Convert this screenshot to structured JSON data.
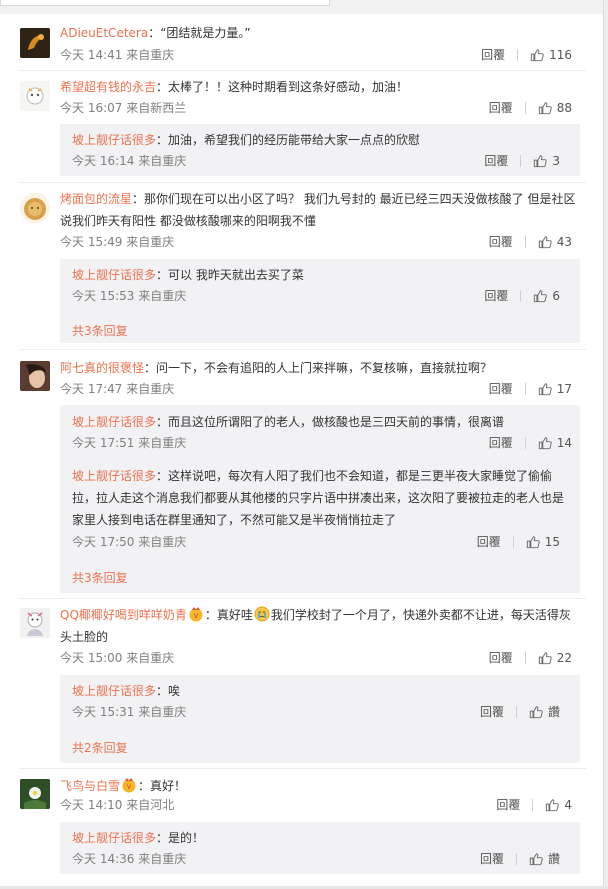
{
  "comments": [
    {
      "name": "ADieuEtCetera",
      "text": "：“团结就是力量。”",
      "time": "今天 14:41 来自重庆",
      "reply": "回覆",
      "likes": "116"
    },
    {
      "name": "希望超有钱的永吉",
      "text": "：太棒了！！这种时期看到这条好感动，加油！",
      "time": "今天 16:07 来自新西兰",
      "reply": "回覆",
      "likes": "88",
      "replies": [
        {
          "name": "坡上靓仔话很多",
          "text": "：加油，希望我们的经历能带给大家一点点的欣慰",
          "time": "今天 16:14 来自重庆",
          "reply": "回覆",
          "likes": "3"
        }
      ]
    },
    {
      "name": "烤面包的流星",
      "text": "：那你们现在可以出小区了吗？ 我们九号封的 最近已经三四天没做核酸了 但是社区说我们昨天有阳性 都没做核酸哪来的阳啊我不懂",
      "time": "今天 15:49 来自重庆",
      "reply": "回覆",
      "likes": "43",
      "replies": [
        {
          "name": "坡上靓仔话很多",
          "text": "：可以 我昨天就出去买了菜",
          "time": "今天 15:53 来自重庆",
          "reply": "回覆",
          "likes": "6"
        }
      ],
      "more": "共3条回复"
    },
    {
      "name": "阿七真的很褒怪",
      "text": "：问一下，不会有追阳的人上门来拌嘛，不复核嘛，直接就拉啊？",
      "time": "今天 17:47 来自重庆",
      "reply": "回覆",
      "likes": "17",
      "replies": [
        {
          "name": "坡上靓仔话很多",
          "text": "：而且这位所谓阳了的老人，做核酸也是三四天前的事情，很离谱",
          "time": "今天 17:51 来自重庆",
          "reply": "回覆",
          "likes": "14"
        },
        {
          "name": "坡上靓仔话很多",
          "text": "：这样说吧，每次有人阳了我们也不会知道，都是三更半夜大家睡觉了偷偷拉，拉人走这个消息我们都要从其他楼的只字片语中拼凑出来，这次阳了要被拉走的老人也是家里人接到电话在群里通知了，不然可能又是半夜悄悄拉走了",
          "time": "今天 17:50 来自重庆",
          "reply": "回覆",
          "likes": "15"
        }
      ],
      "more": "共3条回复"
    },
    {
      "name": "QQ椰椰好喝到咩咩奶青",
      "text_a": "：真好哇",
      "text_b": "我们学校封了一个月了，快递外卖都不让进，每天活得灰头土脸的",
      "time": "今天 15:00 来自重庆",
      "reply": "回覆",
      "likes": "22",
      "replies": [
        {
          "name": "坡上靓仔话很多",
          "text": "：唉",
          "time": "今天 15:31 来自重庆",
          "reply": "回覆",
          "likes": "讚"
        }
      ],
      "more": "共2条回复"
    },
    {
      "name": "飞鸟与白雪",
      "text": "：真好！",
      "time": "今天 14:10 来自河北",
      "reply": "回覆",
      "likes": "4",
      "replies": [
        {
          "name": "坡上靓仔话很多",
          "text": "：是的！",
          "time": "今天 14:36 来自重庆",
          "reply": "回覆",
          "likes": "讚"
        }
      ]
    }
  ],
  "colors": {
    "name": "#eb7350",
    "meta": "#808080",
    "subbox": "#f2f2f5"
  },
  "icons": {
    "like": "thumbs-up-icon",
    "vip": "vip-badge-icon",
    "emoji": "crying-face-emoji"
  }
}
